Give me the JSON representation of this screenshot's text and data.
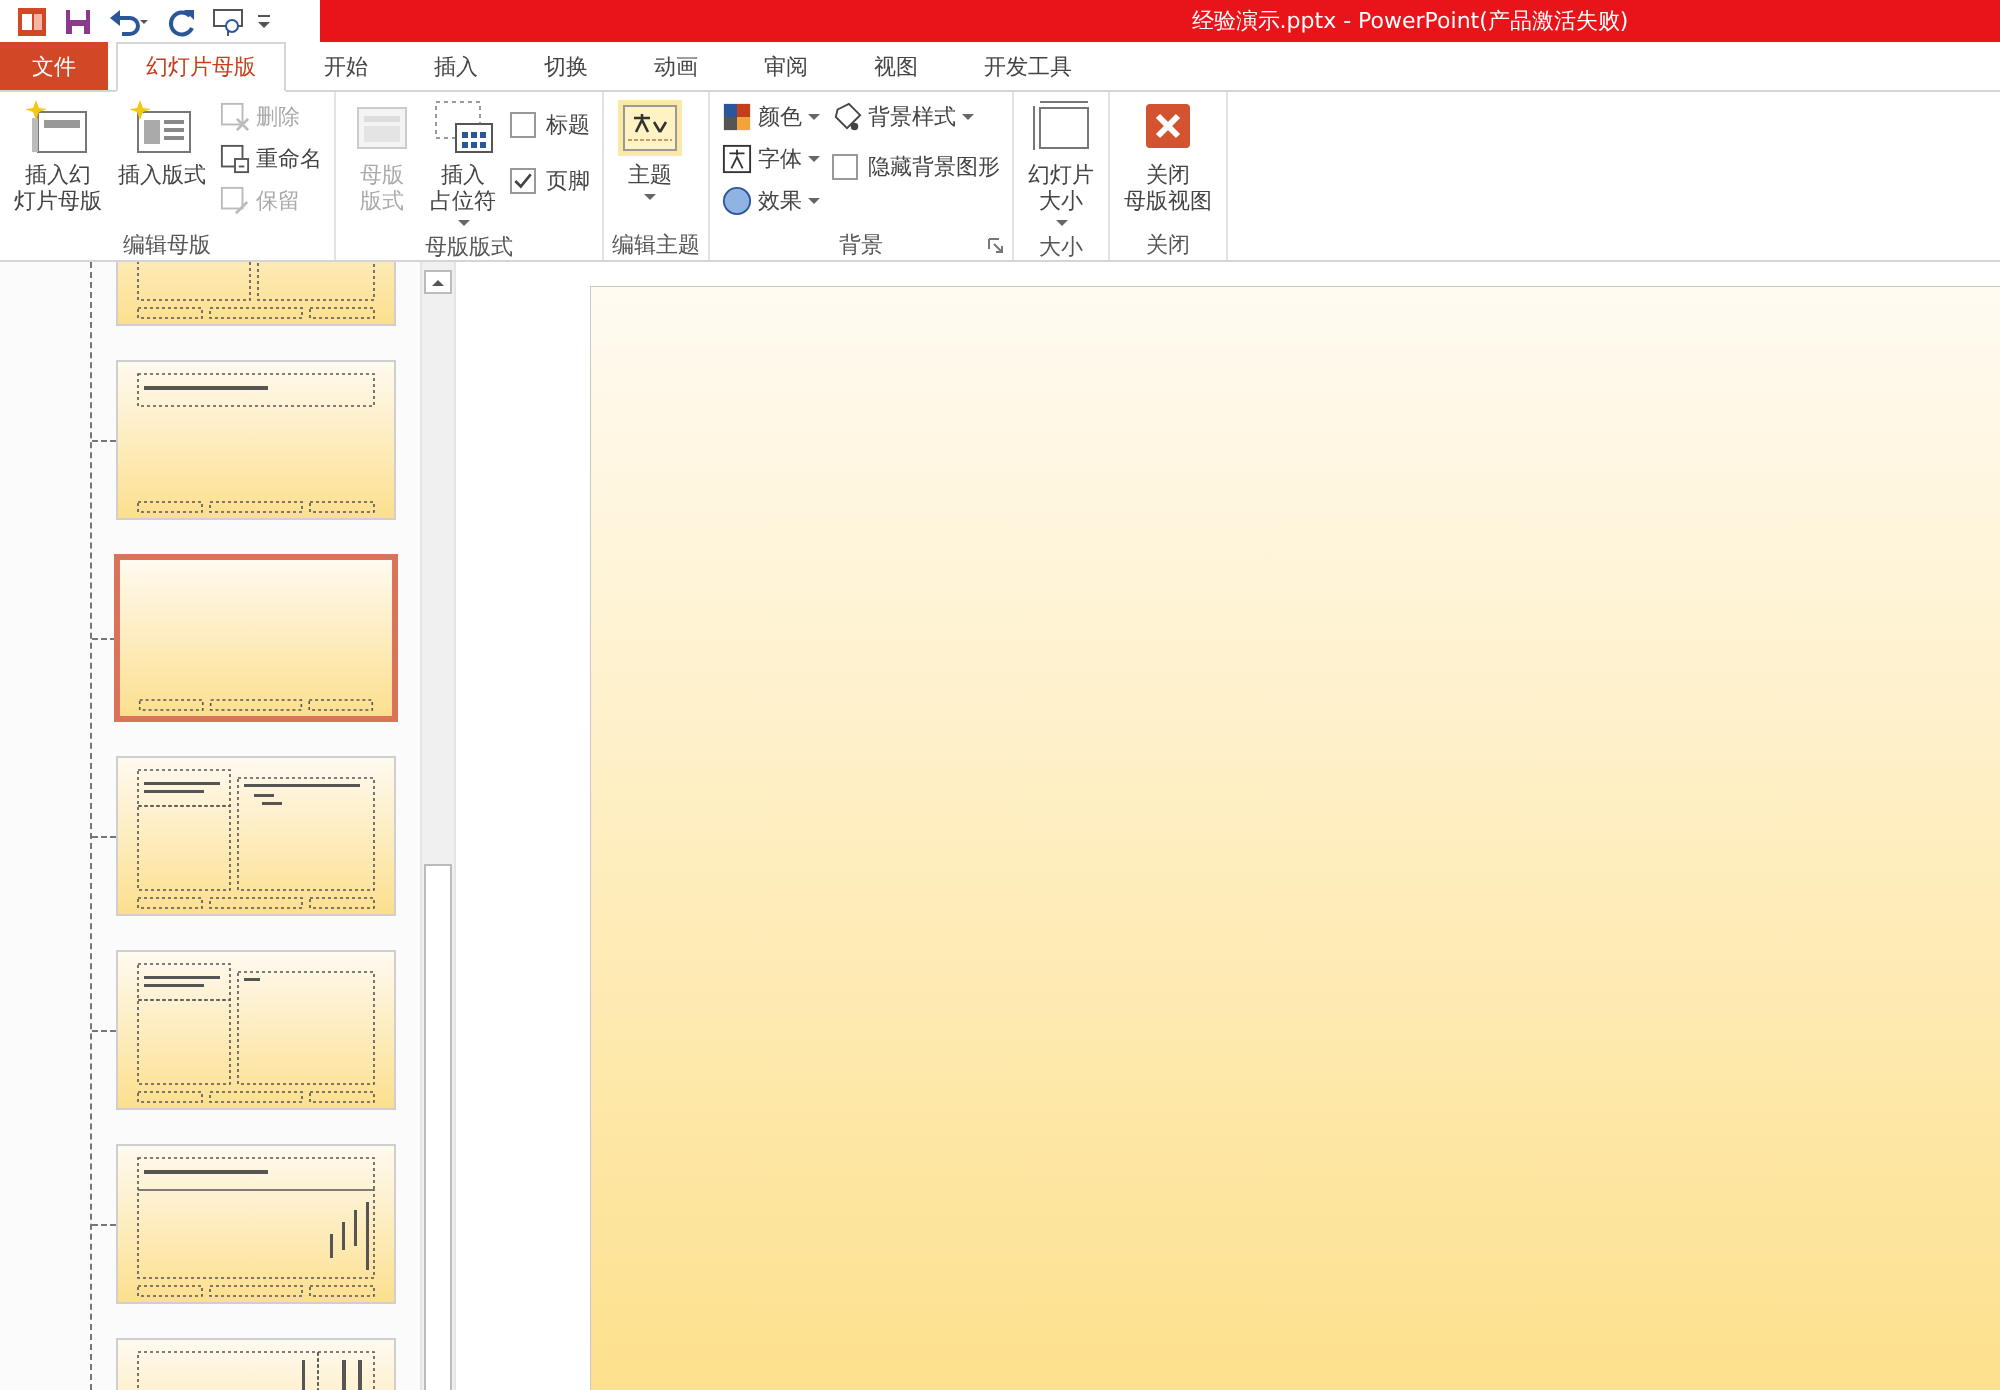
{
  "window": {
    "title": "经验演示.pptx -  PowerPoint(产品激活失败)"
  },
  "tabs": [
    {
      "label": "文件",
      "kind": "file",
      "selected": false
    },
    {
      "label": "幻灯片母版",
      "kind": "tab",
      "selected": true
    },
    {
      "label": "开始",
      "kind": "tab",
      "selected": false
    },
    {
      "label": "插入",
      "kind": "tab",
      "selected": false
    },
    {
      "label": "切换",
      "kind": "tab",
      "selected": false
    },
    {
      "label": "动画",
      "kind": "tab",
      "selected": false
    },
    {
      "label": "审阅",
      "kind": "tab",
      "selected": false
    },
    {
      "label": "视图",
      "kind": "tab",
      "selected": false
    },
    {
      "label": "开发工具",
      "kind": "tab",
      "selected": false
    }
  ],
  "ribbon": [
    {
      "label": "编辑母版",
      "launcher": false,
      "columns": [
        [
          {
            "kind": "large",
            "lines": [
              "插入幻",
              "灯片母版"
            ],
            "disabled": false,
            "dropdown": false
          }
        ],
        [
          {
            "kind": "large",
            "lines": [
              "插入版式"
            ],
            "disabled": false,
            "dropdown": false
          }
        ],
        [
          {
            "kind": "small",
            "label": "删除",
            "disabled": true,
            "dropdown": false
          },
          {
            "kind": "small",
            "label": "重命名",
            "disabled": false,
            "dropdown": false
          },
          {
            "kind": "small",
            "label": "保留",
            "disabled": true,
            "dropdown": false
          }
        ]
      ]
    },
    {
      "label": "母版版式",
      "launcher": false,
      "columns": [
        [
          {
            "kind": "large",
            "lines": [
              "母版",
              "版式"
            ],
            "disabled": true,
            "dropdown": false
          }
        ],
        [
          {
            "kind": "large",
            "lines": [
              "插入",
              "占位符"
            ],
            "disabled": false,
            "dropdown": true
          }
        ],
        [
          {
            "kind": "check",
            "label": "标题",
            "checked": false
          },
          {
            "kind": "check",
            "label": "页脚",
            "checked": true
          }
        ]
      ]
    },
    {
      "label": "编辑主题",
      "launcher": false,
      "columns": [
        [
          {
            "kind": "large",
            "lines": [
              "主题"
            ],
            "disabled": false,
            "dropdown": true
          }
        ]
      ]
    },
    {
      "label": "背景",
      "launcher": true,
      "columns": [
        [
          {
            "kind": "small",
            "label": "颜色",
            "disabled": false,
            "dropdown": true
          },
          {
            "kind": "small",
            "label": "字体",
            "disabled": false,
            "dropdown": true
          },
          {
            "kind": "small",
            "label": "效果",
            "disabled": false,
            "dropdown": true
          }
        ],
        [
          {
            "kind": "small",
            "label": "背景样式",
            "disabled": false,
            "dropdown": true
          },
          {
            "kind": "check",
            "label": "隐藏背景图形",
            "checked": false
          }
        ]
      ]
    },
    {
      "label": "大小",
      "launcher": false,
      "columns": [
        [
          {
            "kind": "large",
            "lines": [
              "幻灯片",
              "大小"
            ],
            "disabled": false,
            "dropdown": true
          }
        ]
      ]
    },
    {
      "label": "关闭",
      "launcher": false,
      "columns": [
        [
          {
            "kind": "large",
            "lines": [
              "关闭",
              "母版视图"
            ],
            "disabled": false,
            "dropdown": false
          }
        ]
      ]
    }
  ],
  "thumbnails": [
    {
      "kind": "two-content",
      "selected": false
    },
    {
      "kind": "title-only",
      "selected": false
    },
    {
      "kind": "blank",
      "selected": true
    },
    {
      "kind": "content-caption",
      "selected": false
    },
    {
      "kind": "picture-caption",
      "selected": false
    },
    {
      "kind": "vertical-body",
      "selected": false
    },
    {
      "kind": "vertical-title",
      "selected": false
    }
  ]
}
